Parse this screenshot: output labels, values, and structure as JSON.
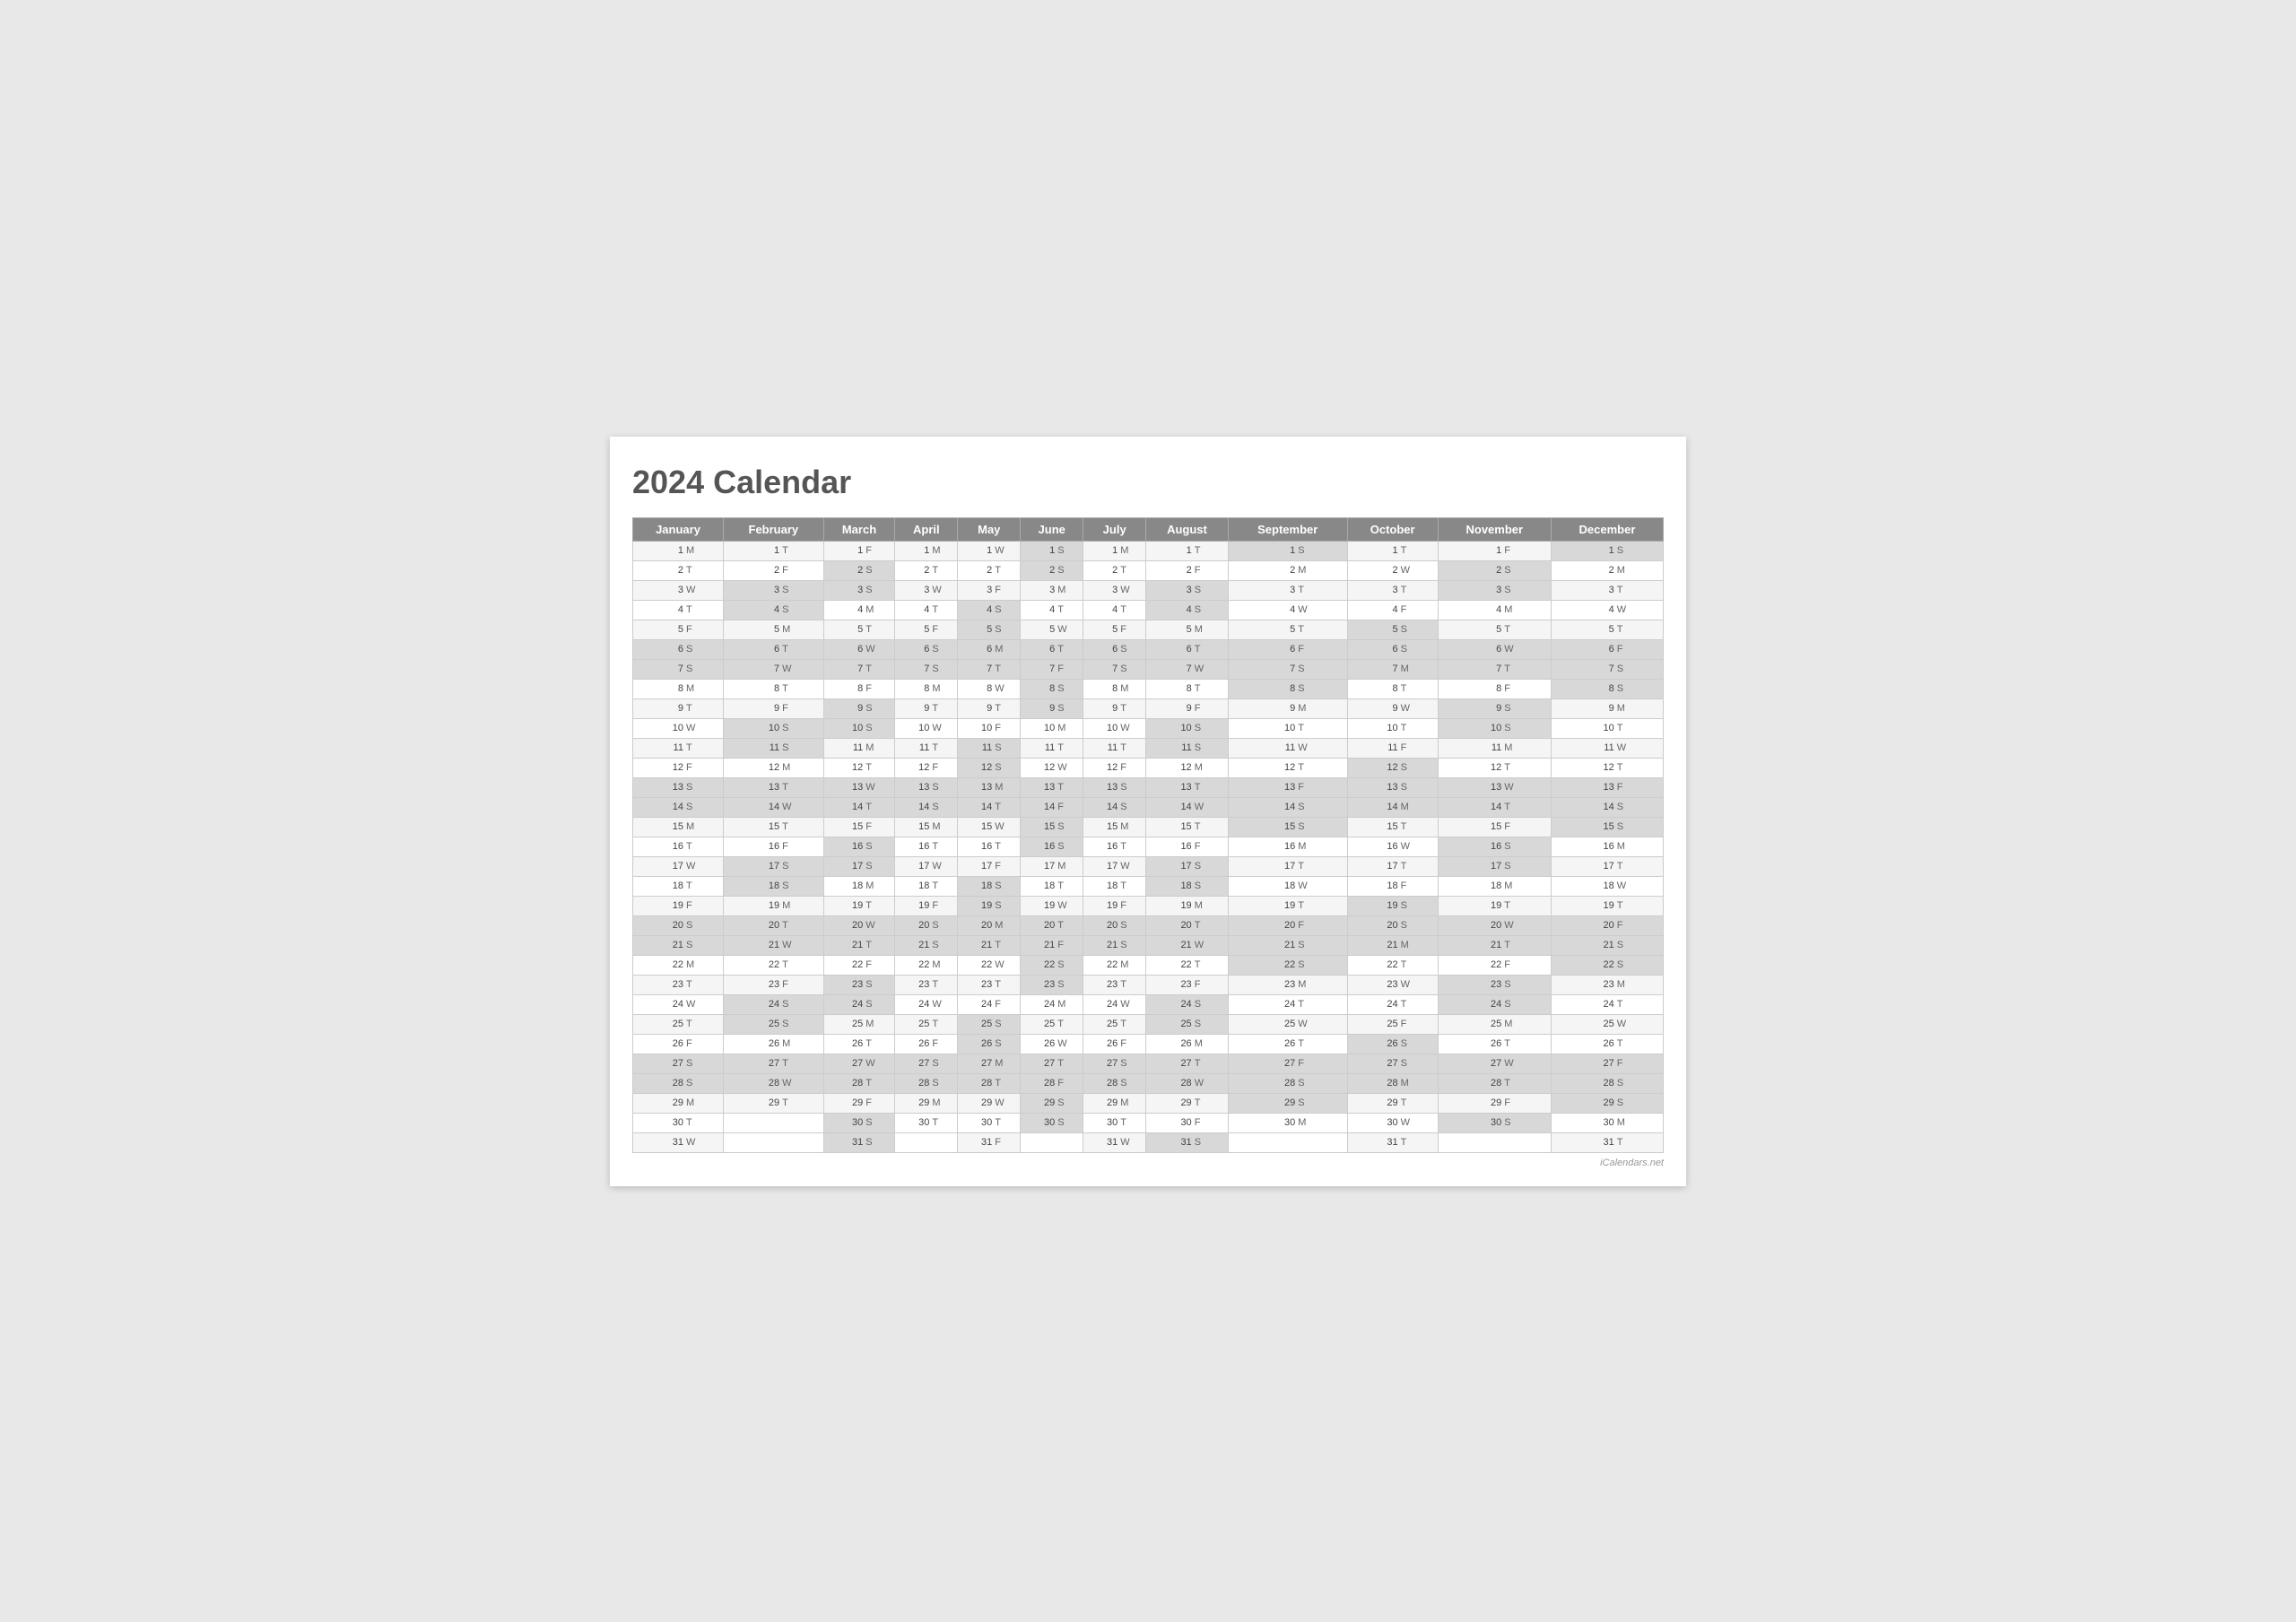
{
  "title": "2024 Calendar",
  "footer": "iCalendars.net",
  "months": [
    "January",
    "February",
    "March",
    "April",
    "May",
    "June",
    "July",
    "August",
    "September",
    "October",
    "November",
    "December"
  ],
  "days": {
    "jan": [
      [
        "1",
        "M"
      ],
      [
        "2",
        "T"
      ],
      [
        "3",
        "W"
      ],
      [
        "4",
        "T"
      ],
      [
        "5",
        "F"
      ],
      [
        "6",
        "S"
      ],
      [
        "7",
        "S"
      ],
      [
        "8",
        "M"
      ],
      [
        "9",
        "T"
      ],
      [
        "10",
        "W"
      ],
      [
        "11",
        "T"
      ],
      [
        "12",
        "F"
      ],
      [
        "13",
        "S"
      ],
      [
        "14",
        "S"
      ],
      [
        "15",
        "M"
      ],
      [
        "16",
        "T"
      ],
      [
        "17",
        "W"
      ],
      [
        "18",
        "T"
      ],
      [
        "19",
        "F"
      ],
      [
        "20",
        "S"
      ],
      [
        "21",
        "S"
      ],
      [
        "22",
        "M"
      ],
      [
        "23",
        "T"
      ],
      [
        "24",
        "W"
      ],
      [
        "25",
        "T"
      ],
      [
        "26",
        "F"
      ],
      [
        "27",
        "S"
      ],
      [
        "28",
        "S"
      ],
      [
        "29",
        "M"
      ],
      [
        "30",
        "T"
      ],
      [
        "31",
        "W"
      ]
    ],
    "feb": [
      [
        "1",
        "T"
      ],
      [
        "2",
        "F"
      ],
      [
        "3",
        "S"
      ],
      [
        "4",
        "S"
      ],
      [
        "5",
        "M"
      ],
      [
        "6",
        "T"
      ],
      [
        "7",
        "W"
      ],
      [
        "8",
        "T"
      ],
      [
        "9",
        "F"
      ],
      [
        "10",
        "S"
      ],
      [
        "11",
        "S"
      ],
      [
        "12",
        "M"
      ],
      [
        "13",
        "T"
      ],
      [
        "14",
        "W"
      ],
      [
        "15",
        "T"
      ],
      [
        "16",
        "F"
      ],
      [
        "17",
        "S"
      ],
      [
        "18",
        "S"
      ],
      [
        "19",
        "M"
      ],
      [
        "20",
        "T"
      ],
      [
        "21",
        "W"
      ],
      [
        "22",
        "T"
      ],
      [
        "23",
        "F"
      ],
      [
        "24",
        "S"
      ],
      [
        "25",
        "S"
      ],
      [
        "26",
        "M"
      ],
      [
        "27",
        "T"
      ],
      [
        "28",
        "W"
      ],
      [
        "29",
        "T"
      ],
      [
        "",
        ""
      ],
      [
        "",
        ""
      ]
    ],
    "mar": [
      [
        "1",
        "F"
      ],
      [
        "2",
        "S"
      ],
      [
        "3",
        "S"
      ],
      [
        "4",
        "M"
      ],
      [
        "5",
        "T"
      ],
      [
        "6",
        "W"
      ],
      [
        "7",
        "T"
      ],
      [
        "8",
        "F"
      ],
      [
        "9",
        "S"
      ],
      [
        "10",
        "S"
      ],
      [
        "11",
        "M"
      ],
      [
        "12",
        "T"
      ],
      [
        "13",
        "W"
      ],
      [
        "14",
        "T"
      ],
      [
        "15",
        "F"
      ],
      [
        "16",
        "S"
      ],
      [
        "17",
        "S"
      ],
      [
        "18",
        "M"
      ],
      [
        "19",
        "T"
      ],
      [
        "20",
        "W"
      ],
      [
        "21",
        "T"
      ],
      [
        "22",
        "F"
      ],
      [
        "23",
        "S"
      ],
      [
        "24",
        "S"
      ],
      [
        "25",
        "M"
      ],
      [
        "26",
        "T"
      ],
      [
        "27",
        "W"
      ],
      [
        "28",
        "T"
      ],
      [
        "29",
        "F"
      ],
      [
        "30",
        "S"
      ],
      [
        "31",
        "S"
      ]
    ],
    "apr": [
      [
        "1",
        "M"
      ],
      [
        "2",
        "T"
      ],
      [
        "3",
        "W"
      ],
      [
        "4",
        "T"
      ],
      [
        "5",
        "F"
      ],
      [
        "6",
        "S"
      ],
      [
        "7",
        "S"
      ],
      [
        "8",
        "M"
      ],
      [
        "9",
        "T"
      ],
      [
        "10",
        "W"
      ],
      [
        "11",
        "T"
      ],
      [
        "12",
        "F"
      ],
      [
        "13",
        "S"
      ],
      [
        "14",
        "S"
      ],
      [
        "15",
        "M"
      ],
      [
        "16",
        "T"
      ],
      [
        "17",
        "W"
      ],
      [
        "18",
        "T"
      ],
      [
        "19",
        "F"
      ],
      [
        "20",
        "S"
      ],
      [
        "21",
        "S"
      ],
      [
        "22",
        "M"
      ],
      [
        "23",
        "T"
      ],
      [
        "24",
        "W"
      ],
      [
        "25",
        "T"
      ],
      [
        "26",
        "F"
      ],
      [
        "27",
        "S"
      ],
      [
        "28",
        "S"
      ],
      [
        "29",
        "M"
      ],
      [
        "30",
        "T"
      ],
      [
        "",
        ""
      ]
    ],
    "may": [
      [
        "1",
        "W"
      ],
      [
        "2",
        "T"
      ],
      [
        "3",
        "F"
      ],
      [
        "4",
        "S"
      ],
      [
        "5",
        "S"
      ],
      [
        "6",
        "M"
      ],
      [
        "7",
        "T"
      ],
      [
        "8",
        "W"
      ],
      [
        "9",
        "T"
      ],
      [
        "10",
        "F"
      ],
      [
        "11",
        "S"
      ],
      [
        "12",
        "S"
      ],
      [
        "13",
        "M"
      ],
      [
        "14",
        "T"
      ],
      [
        "15",
        "W"
      ],
      [
        "16",
        "T"
      ],
      [
        "17",
        "F"
      ],
      [
        "18",
        "S"
      ],
      [
        "19",
        "S"
      ],
      [
        "20",
        "M"
      ],
      [
        "21",
        "T"
      ],
      [
        "22",
        "W"
      ],
      [
        "23",
        "T"
      ],
      [
        "24",
        "F"
      ],
      [
        "25",
        "S"
      ],
      [
        "26",
        "S"
      ],
      [
        "27",
        "M"
      ],
      [
        "28",
        "T"
      ],
      [
        "29",
        "W"
      ],
      [
        "30",
        "T"
      ],
      [
        "31",
        "F"
      ]
    ],
    "jun": [
      [
        "1",
        "S"
      ],
      [
        "2",
        "S"
      ],
      [
        "3",
        "M"
      ],
      [
        "4",
        "T"
      ],
      [
        "5",
        "W"
      ],
      [
        "6",
        "T"
      ],
      [
        "7",
        "F"
      ],
      [
        "8",
        "S"
      ],
      [
        "9",
        "S"
      ],
      [
        "10",
        "M"
      ],
      [
        "11",
        "T"
      ],
      [
        "12",
        "W"
      ],
      [
        "13",
        "T"
      ],
      [
        "14",
        "F"
      ],
      [
        "15",
        "S"
      ],
      [
        "16",
        "S"
      ],
      [
        "17",
        "M"
      ],
      [
        "18",
        "T"
      ],
      [
        "19",
        "W"
      ],
      [
        "20",
        "T"
      ],
      [
        "21",
        "F"
      ],
      [
        "22",
        "S"
      ],
      [
        "23",
        "S"
      ],
      [
        "24",
        "M"
      ],
      [
        "25",
        "T"
      ],
      [
        "26",
        "W"
      ],
      [
        "27",
        "T"
      ],
      [
        "28",
        "F"
      ],
      [
        "29",
        "S"
      ],
      [
        "30",
        "S"
      ],
      [
        "",
        ""
      ]
    ],
    "jul": [
      [
        "1",
        "M"
      ],
      [
        "2",
        "T"
      ],
      [
        "3",
        "W"
      ],
      [
        "4",
        "T"
      ],
      [
        "5",
        "F"
      ],
      [
        "6",
        "S"
      ],
      [
        "7",
        "S"
      ],
      [
        "8",
        "M"
      ],
      [
        "9",
        "T"
      ],
      [
        "10",
        "W"
      ],
      [
        "11",
        "T"
      ],
      [
        "12",
        "F"
      ],
      [
        "13",
        "S"
      ],
      [
        "14",
        "S"
      ],
      [
        "15",
        "M"
      ],
      [
        "16",
        "T"
      ],
      [
        "17",
        "W"
      ],
      [
        "18",
        "T"
      ],
      [
        "19",
        "F"
      ],
      [
        "20",
        "S"
      ],
      [
        "21",
        "S"
      ],
      [
        "22",
        "M"
      ],
      [
        "23",
        "T"
      ],
      [
        "24",
        "W"
      ],
      [
        "25",
        "T"
      ],
      [
        "26",
        "F"
      ],
      [
        "27",
        "S"
      ],
      [
        "28",
        "S"
      ],
      [
        "29",
        "M"
      ],
      [
        "30",
        "T"
      ],
      [
        "31",
        "W"
      ]
    ],
    "aug": [
      [
        "1",
        "T"
      ],
      [
        "2",
        "F"
      ],
      [
        "3",
        "S"
      ],
      [
        "4",
        "S"
      ],
      [
        "5",
        "M"
      ],
      [
        "6",
        "T"
      ],
      [
        "7",
        "W"
      ],
      [
        "8",
        "T"
      ],
      [
        "9",
        "F"
      ],
      [
        "10",
        "S"
      ],
      [
        "11",
        "S"
      ],
      [
        "12",
        "M"
      ],
      [
        "13",
        "T"
      ],
      [
        "14",
        "W"
      ],
      [
        "15",
        "T"
      ],
      [
        "16",
        "F"
      ],
      [
        "17",
        "S"
      ],
      [
        "18",
        "S"
      ],
      [
        "19",
        "M"
      ],
      [
        "20",
        "T"
      ],
      [
        "21",
        "W"
      ],
      [
        "22",
        "T"
      ],
      [
        "23",
        "F"
      ],
      [
        "24",
        "S"
      ],
      [
        "25",
        "S"
      ],
      [
        "26",
        "M"
      ],
      [
        "27",
        "T"
      ],
      [
        "28",
        "W"
      ],
      [
        "29",
        "T"
      ],
      [
        "30",
        "F"
      ],
      [
        "31",
        "S"
      ]
    ],
    "sep": [
      [
        "1",
        "S"
      ],
      [
        "2",
        "M"
      ],
      [
        "3",
        "T"
      ],
      [
        "4",
        "W"
      ],
      [
        "5",
        "T"
      ],
      [
        "6",
        "F"
      ],
      [
        "7",
        "S"
      ],
      [
        "8",
        "S"
      ],
      [
        "9",
        "M"
      ],
      [
        "10",
        "T"
      ],
      [
        "11",
        "W"
      ],
      [
        "12",
        "T"
      ],
      [
        "13",
        "F"
      ],
      [
        "14",
        "S"
      ],
      [
        "15",
        "S"
      ],
      [
        "16",
        "M"
      ],
      [
        "17",
        "T"
      ],
      [
        "18",
        "W"
      ],
      [
        "19",
        "T"
      ],
      [
        "20",
        "F"
      ],
      [
        "21",
        "S"
      ],
      [
        "22",
        "S"
      ],
      [
        "23",
        "M"
      ],
      [
        "24",
        "T"
      ],
      [
        "25",
        "W"
      ],
      [
        "26",
        "T"
      ],
      [
        "27",
        "F"
      ],
      [
        "28",
        "S"
      ],
      [
        "29",
        "S"
      ],
      [
        "30",
        "M"
      ],
      [
        "",
        ""
      ]
    ],
    "oct": [
      [
        "1",
        "T"
      ],
      [
        "2",
        "W"
      ],
      [
        "3",
        "T"
      ],
      [
        "4",
        "F"
      ],
      [
        "5",
        "S"
      ],
      [
        "6",
        "S"
      ],
      [
        "7",
        "M"
      ],
      [
        "8",
        "T"
      ],
      [
        "9",
        "W"
      ],
      [
        "10",
        "T"
      ],
      [
        "11",
        "F"
      ],
      [
        "12",
        "S"
      ],
      [
        "13",
        "S"
      ],
      [
        "14",
        "M"
      ],
      [
        "15",
        "T"
      ],
      [
        "16",
        "W"
      ],
      [
        "17",
        "T"
      ],
      [
        "18",
        "F"
      ],
      [
        "19",
        "S"
      ],
      [
        "20",
        "S"
      ],
      [
        "21",
        "M"
      ],
      [
        "22",
        "T"
      ],
      [
        "23",
        "W"
      ],
      [
        "24",
        "T"
      ],
      [
        "25",
        "F"
      ],
      [
        "26",
        "S"
      ],
      [
        "27",
        "S"
      ],
      [
        "28",
        "M"
      ],
      [
        "29",
        "T"
      ],
      [
        "30",
        "W"
      ],
      [
        "31",
        "T"
      ]
    ],
    "nov": [
      [
        "1",
        "F"
      ],
      [
        "2",
        "S"
      ],
      [
        "3",
        "S"
      ],
      [
        "4",
        "M"
      ],
      [
        "5",
        "T"
      ],
      [
        "6",
        "W"
      ],
      [
        "7",
        "T"
      ],
      [
        "8",
        "F"
      ],
      [
        "9",
        "S"
      ],
      [
        "10",
        "S"
      ],
      [
        "11",
        "M"
      ],
      [
        "12",
        "T"
      ],
      [
        "13",
        "W"
      ],
      [
        "14",
        "T"
      ],
      [
        "15",
        "F"
      ],
      [
        "16",
        "S"
      ],
      [
        "17",
        "S"
      ],
      [
        "18",
        "M"
      ],
      [
        "19",
        "T"
      ],
      [
        "20",
        "W"
      ],
      [
        "21",
        "T"
      ],
      [
        "22",
        "F"
      ],
      [
        "23",
        "S"
      ],
      [
        "24",
        "S"
      ],
      [
        "25",
        "M"
      ],
      [
        "26",
        "T"
      ],
      [
        "27",
        "W"
      ],
      [
        "28",
        "T"
      ],
      [
        "29",
        "F"
      ],
      [
        "30",
        "S"
      ],
      [
        "",
        ""
      ]
    ],
    "dec": [
      [
        "1",
        "S"
      ],
      [
        "2",
        "M"
      ],
      [
        "3",
        "T"
      ],
      [
        "4",
        "W"
      ],
      [
        "5",
        "T"
      ],
      [
        "6",
        "F"
      ],
      [
        "7",
        "S"
      ],
      [
        "8",
        "S"
      ],
      [
        "9",
        "M"
      ],
      [
        "10",
        "T"
      ],
      [
        "11",
        "W"
      ],
      [
        "12",
        "T"
      ],
      [
        "13",
        "F"
      ],
      [
        "14",
        "S"
      ],
      [
        "15",
        "S"
      ],
      [
        "16",
        "M"
      ],
      [
        "17",
        "T"
      ],
      [
        "18",
        "W"
      ],
      [
        "19",
        "T"
      ],
      [
        "20",
        "F"
      ],
      [
        "21",
        "S"
      ],
      [
        "22",
        "S"
      ],
      [
        "23",
        "M"
      ],
      [
        "24",
        "T"
      ],
      [
        "25",
        "W"
      ],
      [
        "26",
        "T"
      ],
      [
        "27",
        "F"
      ],
      [
        "28",
        "S"
      ],
      [
        "29",
        "S"
      ],
      [
        "30",
        "M"
      ],
      [
        "31",
        "T"
      ]
    ]
  }
}
